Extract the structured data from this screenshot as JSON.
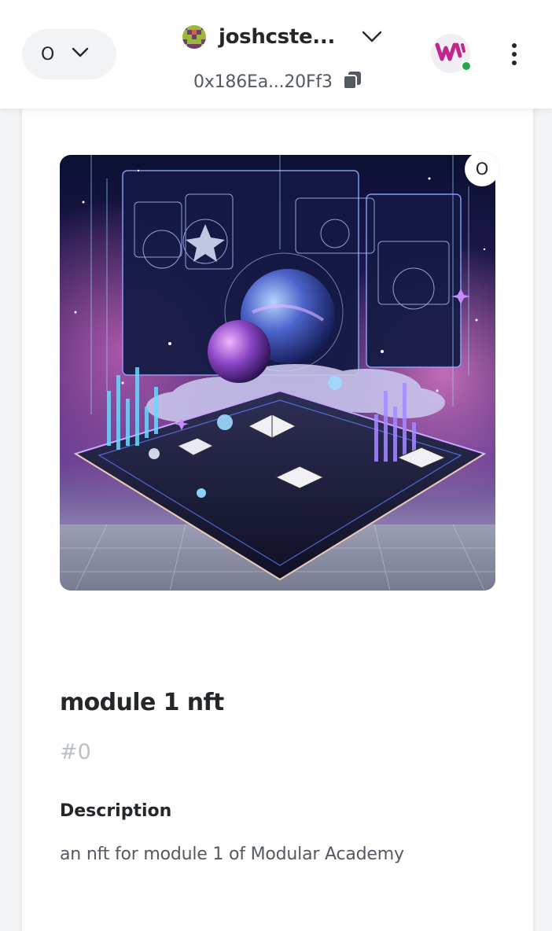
{
  "header": {
    "network": {
      "letter": "O",
      "chevron_icon": "chevron-down-icon"
    },
    "account": {
      "name": "joshcste...",
      "address": "0x186Ea...20Ff3",
      "copy_icon": "copy-icon"
    },
    "site_badge": {
      "icon": "connected-site-icon",
      "status_color": "#28a745"
    },
    "menu_icon": "kebab-menu-icon"
  },
  "nft": {
    "chain_letter": "O",
    "title": "module 1 nft",
    "token_id": "#0",
    "description_label": "Description",
    "description": "an nft for module 1 of Modular Academy",
    "image_icon": "nft-artwork"
  },
  "colors": {
    "text_primary": "#24272a",
    "text_muted": "#bbc0c5",
    "accent_badge": "#d63fa0"
  }
}
